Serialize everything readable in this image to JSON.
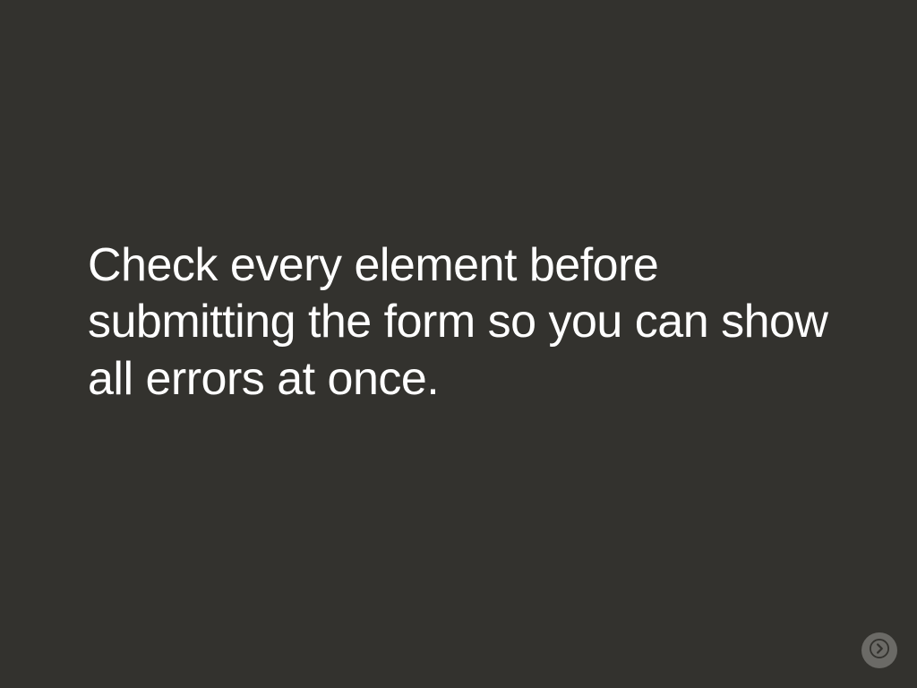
{
  "slide": {
    "text": "Check every element before submitting the form so you can show all errors at once."
  },
  "controls": {
    "next_label": "Next"
  }
}
